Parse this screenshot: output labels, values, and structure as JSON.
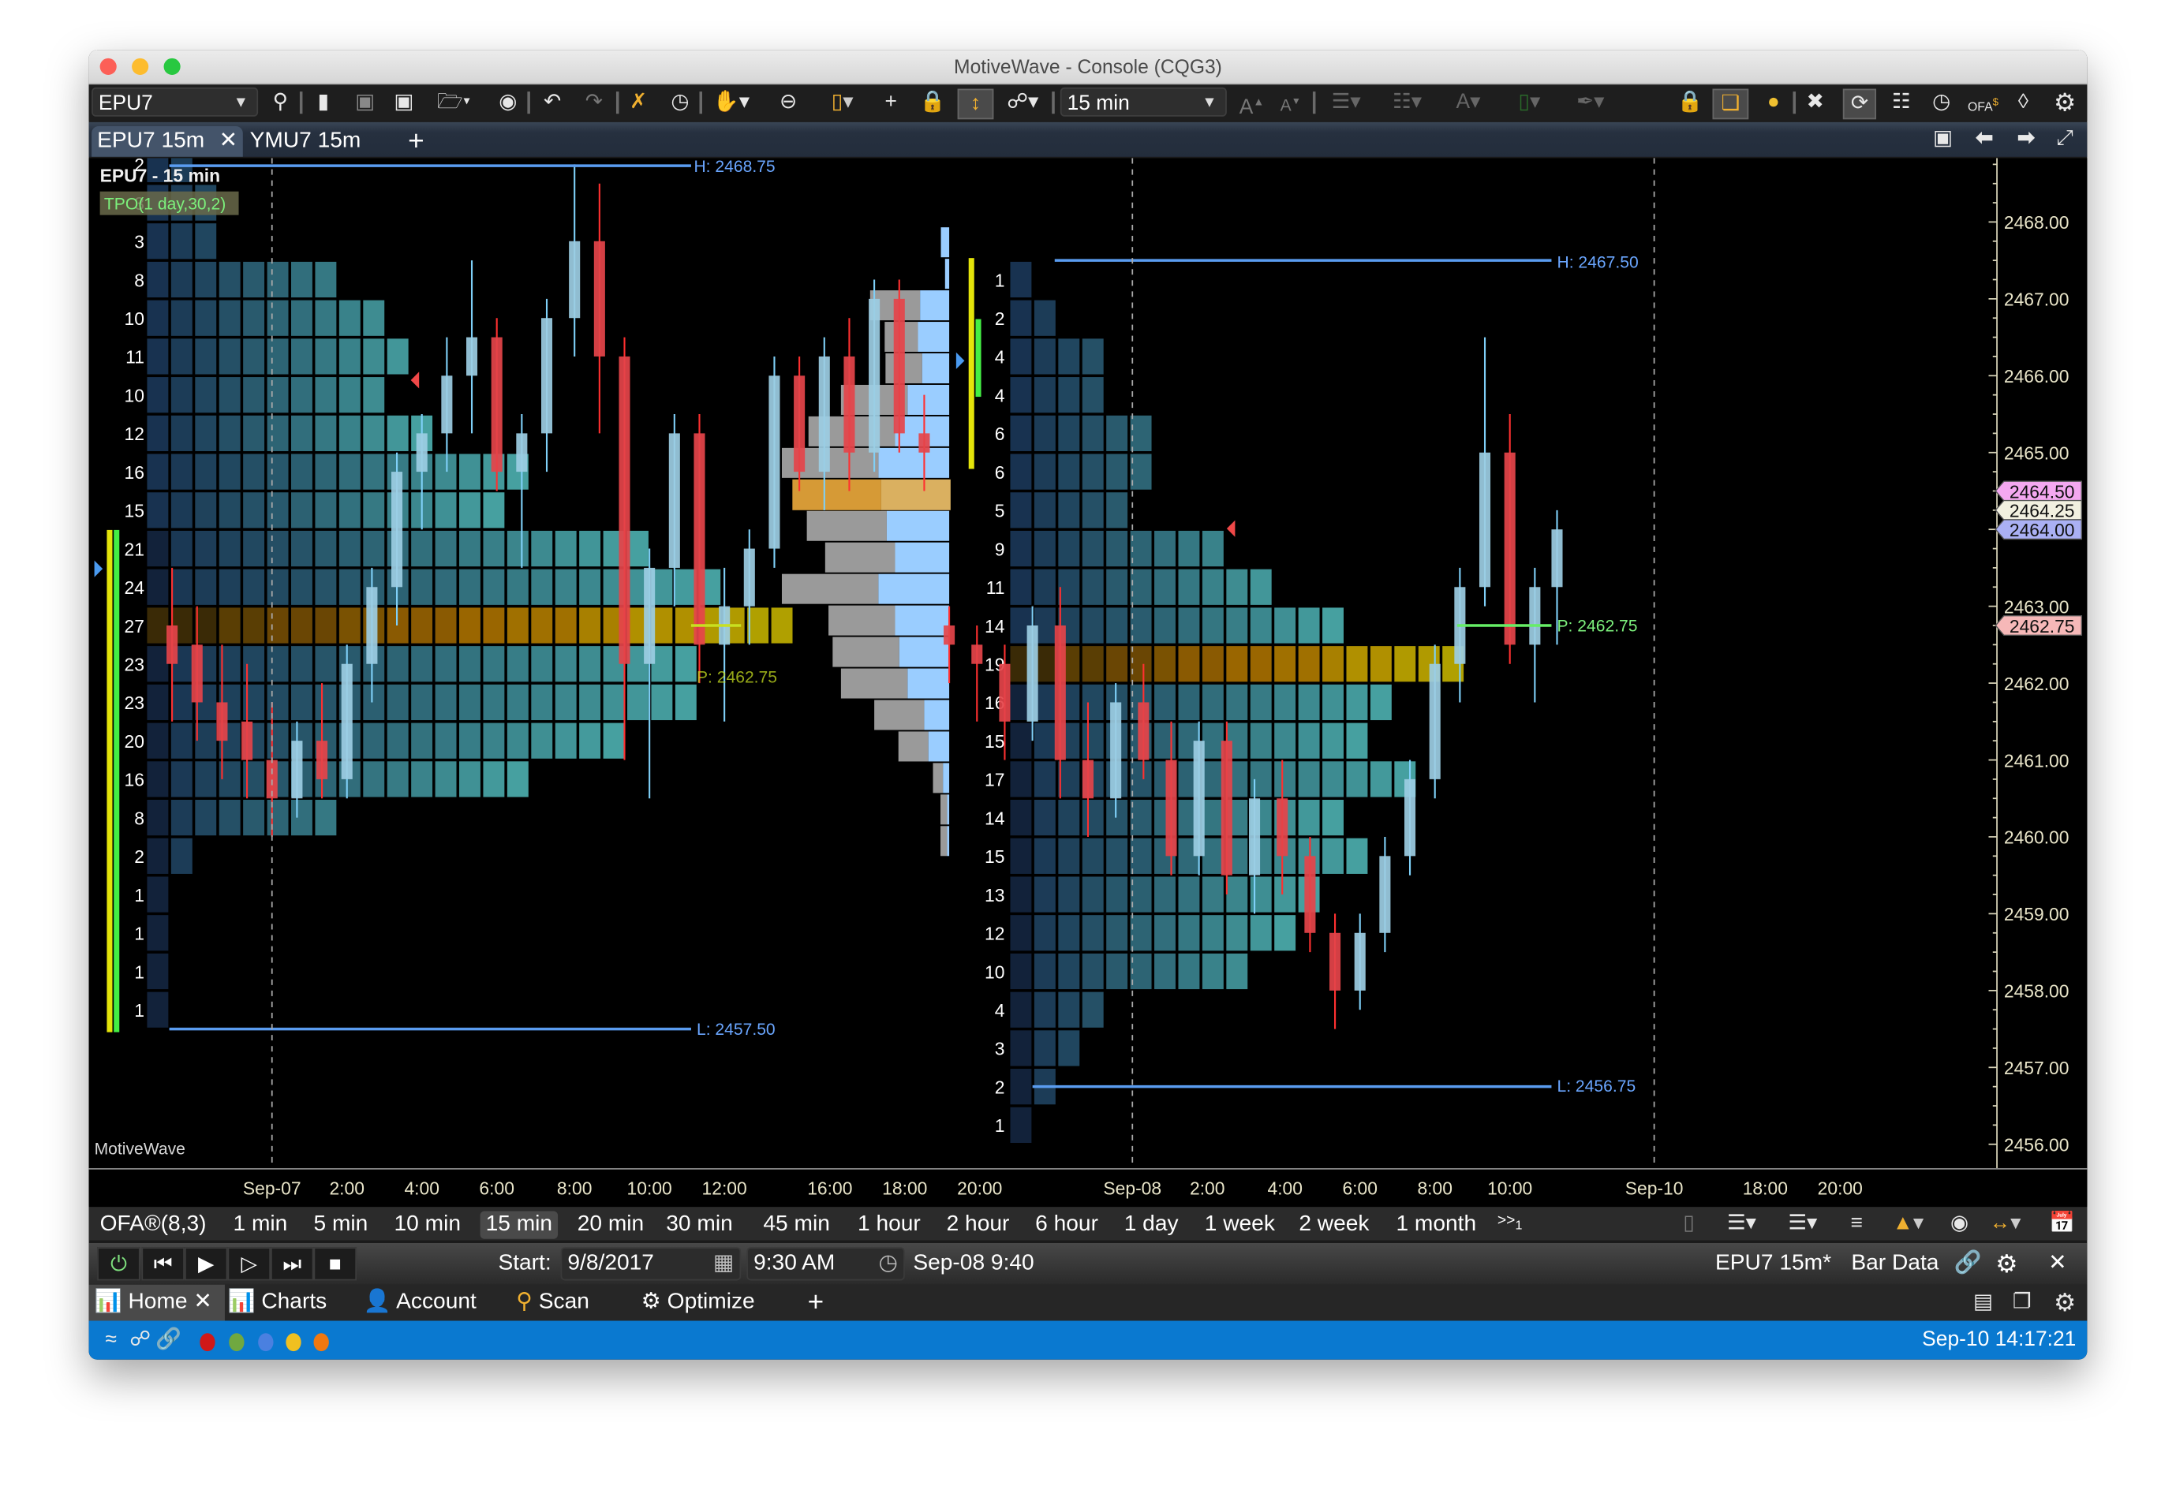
{
  "window": {
    "title": "MotiveWave - Console (CQG3)"
  },
  "toolbar": {
    "symbol": "EPU7",
    "interval": "15 min",
    "icons": [
      "search-icon",
      "new-page-icon",
      "save-icon",
      "save-as-icon",
      "open-folder-icon",
      "camera-icon",
      "undo-icon",
      "redo-icon",
      "auto-trend-icon",
      "alarm-add-icon",
      "hand-pan-icon",
      "zoom-out-icon",
      "bar-style-icon",
      "crosshair-icon",
      "lock-scale-icon",
      "fit-vertical-icon",
      "link-icon",
      "font-increase-icon",
      "font-decrease-icon",
      "line-style-icon",
      "line-dash-icon",
      "text-color-icon",
      "fill-color-icon",
      "brush-icon",
      "lock-chart-icon",
      "overlay-icon",
      "theme-icon",
      "tools-icon",
      "refresh-icon",
      "columns-icon",
      "dollar-clock-icon",
      "ofa-icon",
      "diamond-dollar-icon",
      "gear-icon"
    ]
  },
  "chart_tabs": {
    "tabs": [
      {
        "label": "EPU7 15m",
        "active": true,
        "closable": true
      },
      {
        "label": "YMU7 15m",
        "active": false,
        "closable": false
      }
    ],
    "add_label": "+"
  },
  "chart": {
    "heading": "EPU7 - 15 min",
    "study_label": "TPO(1 day,30,2)",
    "watermark": "MotiveWave",
    "left_profile": {
      "high_label": "H: 2468.75",
      "low_label": "L: 2457.50",
      "poc_label": "P: 2462.75",
      "counts": [
        "2",
        "3",
        "3",
        "8",
        "10",
        "11",
        "10",
        "12",
        "16",
        "15",
        "21",
        "24",
        "27",
        "23",
        "23",
        "20",
        "16",
        "8",
        "2",
        "1",
        "1",
        "1",
        "1"
      ]
    },
    "right_profile": {
      "high_label": "H: 2467.50",
      "low_label": "L: 2456.75",
      "poc_label": "P: 2462.75",
      "counts": [
        "1",
        "2",
        "4",
        "4",
        "6",
        "6",
        "5",
        "9",
        "11",
        "14",
        "19",
        "16",
        "15",
        "17",
        "14",
        "15",
        "13",
        "12",
        "10",
        "4",
        "3",
        "2",
        "1"
      ]
    },
    "price_axis": {
      "ticks": [
        "2468.00",
        "2467.00",
        "2466.00",
        "2465.00",
        "2463.00",
        "2462.00",
        "2461.00",
        "2460.00",
        "2459.00",
        "2458.00",
        "2457.00",
        "2456.00"
      ],
      "markers": [
        {
          "label": "2464.50",
          "color": "#f4a8f0"
        },
        {
          "label": "2464.25",
          "color": "#f2f0e0"
        },
        {
          "label": "2464.00",
          "color": "#aab0f4"
        },
        {
          "label": "2462.75",
          "color": "#f6b8b8"
        }
      ]
    },
    "time_axis": [
      "Sep-07",
      "2:00",
      "4:00",
      "6:00",
      "8:00",
      "10:00",
      "12:00",
      "16:00",
      "18:00",
      "20:00",
      "Sep-08",
      "2:00",
      "4:00",
      "6:00",
      "8:00",
      "10:00",
      "Sep-10",
      "18:00",
      "20:00"
    ],
    "colors": {
      "up_candle": "#9ccde3",
      "down_candle": "#e5444a",
      "high_low_line": "#5a9cf0",
      "poc_line": "#66ee66",
      "poc_band": "#c89a10"
    }
  },
  "periods": {
    "study": "OFA®(8,3)",
    "items": [
      "1 min",
      "5 min",
      "10 min",
      "15 min",
      "20 min",
      "30 min",
      "45 min",
      "1 hour",
      "2 hour",
      "6 hour",
      "1 day",
      "1 week",
      "2 week",
      "1 month"
    ],
    "selected": "15 min",
    "more_label": ">>",
    "more_count": "1"
  },
  "replay": {
    "start_label": "Start:",
    "start_date": "9/8/2017",
    "start_time": "9:30 AM",
    "current_time": "Sep-08 9:40",
    "chart_name": "EPU7 15m*",
    "bar_data_label": "Bar Data"
  },
  "app_tabs": {
    "tabs": [
      {
        "label": "Home",
        "icon": "bar-chart-icon",
        "active": true
      },
      {
        "label": "Charts",
        "icon": "bar-chart-icon",
        "active": false
      },
      {
        "label": "Account",
        "icon": "user-icon",
        "active": false
      },
      {
        "label": "Scan",
        "icon": "scan-icon",
        "active": false
      },
      {
        "label": "Optimize",
        "icon": "sliders-icon",
        "active": false
      }
    ],
    "add_label": "+"
  },
  "status_bar": {
    "clock": "Sep-10 14:17:21",
    "dots": [
      "#d01818",
      "#70a840",
      "#4a80e0",
      "#f0c020",
      "#f07810"
    ]
  }
}
